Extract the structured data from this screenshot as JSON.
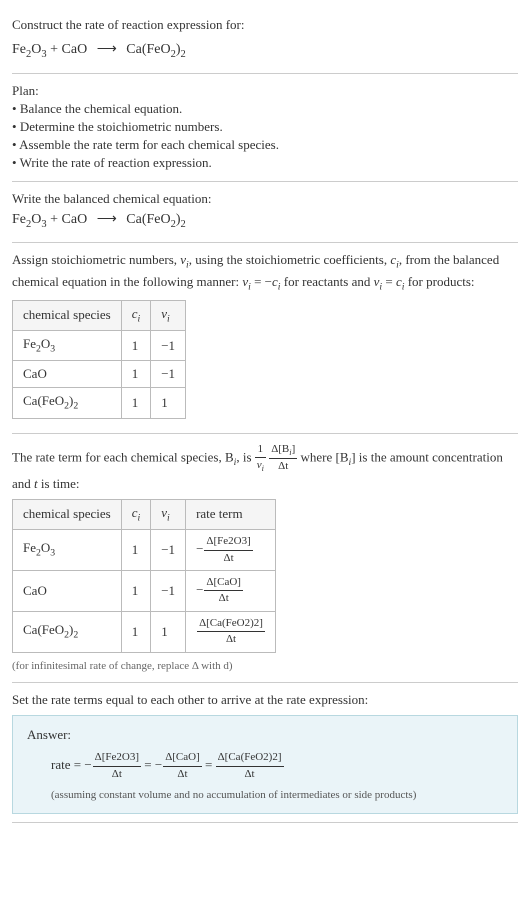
{
  "header": {
    "prompt": "Construct the rate of reaction expression for:"
  },
  "eq": {
    "r1": "Fe",
    "r1s": "2",
    "r1b": "O",
    "r1bs": "3",
    "plus": " + CaO",
    "arrow": "⟶",
    "p1": "Ca(FeO",
    "p1s": "2",
    "p1b": ")",
    "p1bs": "2"
  },
  "plan": {
    "label": "Plan:",
    "items": [
      "Balance the chemical equation.",
      "Determine the stoichiometric numbers.",
      "Assemble the rate term for each chemical species.",
      "Write the rate of reaction expression."
    ]
  },
  "balanced": {
    "label": "Write the balanced chemical equation:"
  },
  "stoich": {
    "intro_a": "Assign stoichiometric numbers, ",
    "intro_b": ", using the stoichiometric coefficients, ",
    "intro_c": ", from the balanced chemical equation in the following manner: ",
    "intro_d": " for reactants and ",
    "intro_e": " for products:",
    "nu": "ν",
    "c": "c",
    "i": "i",
    "eq_react": " = −",
    "eq_prod": " = ",
    "headers": {
      "species": "chemical species",
      "ci": "c",
      "nui": "ν"
    },
    "rows": [
      {
        "species_html": "Fe2O3",
        "ci": "1",
        "nui": "−1"
      },
      {
        "species_html": "CaO",
        "ci": "1",
        "nui": "−1"
      },
      {
        "species_html": "Ca(FeO2)2",
        "ci": "1",
        "nui": "1"
      }
    ]
  },
  "rate_term": {
    "intro_a": "The rate term for each chemical species, B",
    "intro_b": ", is ",
    "intro_c": " where [B",
    "intro_d": "] is the amount concentration and ",
    "intro_e": " is time:",
    "t": "t",
    "one": "1",
    "delta": "Δ",
    "dt": "Δt",
    "headers": {
      "species": "chemical species",
      "ci": "c",
      "nui": "ν",
      "term": "rate term"
    },
    "rows": [
      {
        "ci": "1",
        "nui": "−1",
        "neg": "−",
        "num": "Δ[Fe2O3]",
        "den": "Δt"
      },
      {
        "ci": "1",
        "nui": "−1",
        "neg": "−",
        "num": "Δ[CaO]",
        "den": "Δt"
      },
      {
        "ci": "1",
        "nui": "1",
        "neg": "",
        "num": "Δ[Ca(FeO2)2]",
        "den": "Δt"
      }
    ],
    "note": "(for infinitesimal rate of change, replace Δ with d)"
  },
  "final": {
    "label": "Set the rate terms equal to each other to arrive at the rate expression:"
  },
  "answer": {
    "label": "Answer:",
    "rate": "rate = ",
    "neg": "−",
    "eq": " = ",
    "t1n": "Δ[Fe2O3]",
    "t1d": "Δt",
    "t2n": "Δ[CaO]",
    "t2d": "Δt",
    "t3n": "Δ[Ca(FeO2)2]",
    "t3d": "Δt",
    "note": "(assuming constant volume and no accumulation of intermediates or side products)"
  }
}
